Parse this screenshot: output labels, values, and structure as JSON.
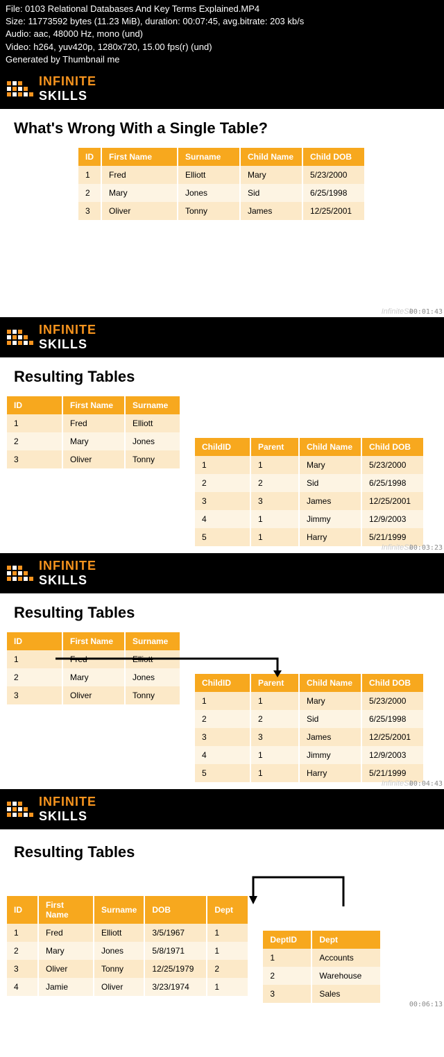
{
  "header": {
    "file": "File: 0103 Relational Databases And Key Terms Explained.MP4",
    "size": "Size: 11773592 bytes (11.23 MiB), duration: 00:07:45, avg.bitrate: 203 kb/s",
    "audio": "Audio: aac, 48000 Hz, mono (und)",
    "video": "Video: h264, yuv420p, 1280x720, 15.00 fps(r) (und)",
    "generated": "Generated by Thumbnail me"
  },
  "logo": {
    "line1": "INFINITE",
    "line2": "SKILLS"
  },
  "slide1": {
    "title": "What's Wrong With a Single Table?",
    "headers": [
      "ID",
      "First Name",
      "Surname",
      "Child Name",
      "Child DOB"
    ],
    "rows": [
      [
        "1",
        "Fred",
        "Elliott",
        "Mary",
        "5/23/2000"
      ],
      [
        "2",
        "Mary",
        "Jones",
        "Sid",
        "6/25/1998"
      ],
      [
        "3",
        "Oliver",
        "Tonny",
        "James",
        "12/25/2001"
      ]
    ],
    "watermark": "InfiniteSk",
    "timestamp": "00:01:43"
  },
  "slide2": {
    "title": "Resulting Tables",
    "table1": {
      "headers": [
        "ID",
        "First Name",
        "Surname"
      ],
      "rows": [
        [
          "1",
          "Fred",
          "Elliott"
        ],
        [
          "2",
          "Mary",
          "Jones"
        ],
        [
          "3",
          "Oliver",
          "Tonny"
        ]
      ]
    },
    "table2": {
      "headers": [
        "ChildID",
        "Parent",
        "Child Name",
        "Child DOB"
      ],
      "rows": [
        [
          "1",
          "1",
          "Mary",
          "5/23/2000"
        ],
        [
          "2",
          "2",
          "Sid",
          "6/25/1998"
        ],
        [
          "3",
          "3",
          "James",
          "12/25/2001"
        ],
        [
          "4",
          "1",
          "Jimmy",
          "12/9/2003"
        ],
        [
          "5",
          "1",
          "Harry",
          "5/21/1999"
        ]
      ]
    },
    "watermark": "InfiniteSk",
    "timestamp": "00:03:23"
  },
  "slide3": {
    "title": "Resulting Tables",
    "table1": {
      "headers": [
        "ID",
        "First Name",
        "Surname"
      ],
      "rows": [
        [
          "1",
          "Fred",
          "Elliott"
        ],
        [
          "2",
          "Mary",
          "Jones"
        ],
        [
          "3",
          "Oliver",
          "Tonny"
        ]
      ]
    },
    "table2": {
      "headers": [
        "ChildID",
        "Parent",
        "Child Name",
        "Child DOB"
      ],
      "rows": [
        [
          "1",
          "1",
          "Mary",
          "5/23/2000"
        ],
        [
          "2",
          "2",
          "Sid",
          "6/25/1998"
        ],
        [
          "3",
          "3",
          "James",
          "12/25/2001"
        ],
        [
          "4",
          "1",
          "Jimmy",
          "12/9/2003"
        ],
        [
          "5",
          "1",
          "Harry",
          "5/21/1999"
        ]
      ]
    },
    "watermark": "InfiniteSk",
    "timestamp": "00:04:43"
  },
  "slide4": {
    "title": "Resulting Tables",
    "table1": {
      "headers": [
        "ID",
        "First Name",
        "Surname",
        "DOB",
        "Dept"
      ],
      "rows": [
        [
          "1",
          "Fred",
          "Elliott",
          "3/5/1967",
          "1"
        ],
        [
          "2",
          "Mary",
          "Jones",
          "5/8/1971",
          "1"
        ],
        [
          "3",
          "Oliver",
          "Tonny",
          "12/25/1979",
          "2"
        ],
        [
          "4",
          "Jamie",
          "Oliver",
          "3/23/1974",
          "1"
        ]
      ]
    },
    "table2": {
      "headers": [
        "DeptID",
        "Dept"
      ],
      "rows": [
        [
          "1",
          "Accounts"
        ],
        [
          "2",
          "Warehouse"
        ],
        [
          "3",
          "Sales"
        ]
      ]
    },
    "timestamp": "00:06:13"
  }
}
